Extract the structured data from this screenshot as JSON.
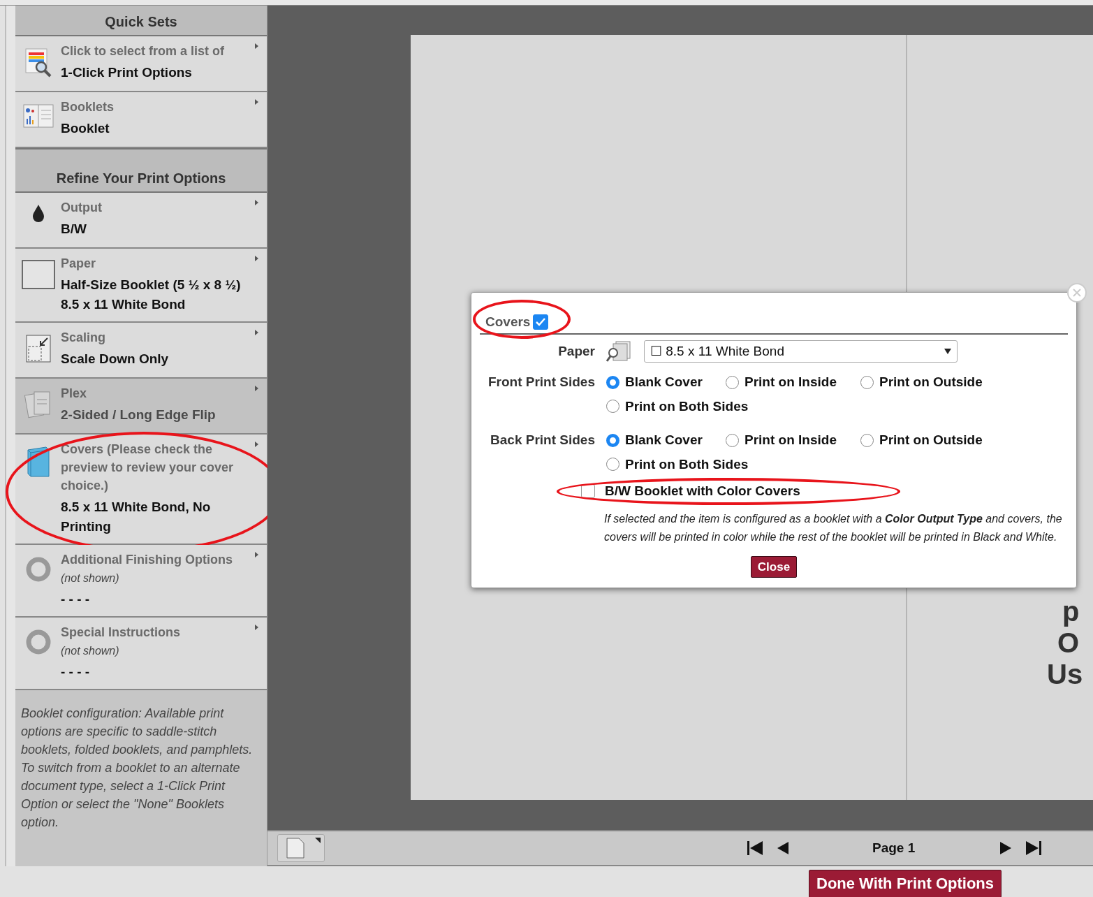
{
  "sidebar": {
    "sections": [
      {
        "title": "Quick Sets",
        "items": [
          {
            "label": "Click to select from a list of",
            "value": "1-Click Print Options",
            "disabled": false,
            "circled": false
          },
          {
            "label": "Booklets",
            "value": "Booklet",
            "disabled": false,
            "circled": false
          }
        ]
      },
      {
        "title": "Refine Your Print Options",
        "items": [
          {
            "label": "Output",
            "value": "B/W",
            "disabled": false,
            "circled": false
          },
          {
            "label": "Paper",
            "value": "Half-Size Booklet (5 ½ x 8 ½)",
            "value_2": "8.5 x 11 White Bond",
            "disabled": false,
            "circled": false
          },
          {
            "label": "Scaling",
            "value": "Scale Down Only",
            "disabled": false,
            "circled": false
          },
          {
            "label": "Plex",
            "value": "2-Sided / Long Edge Flip",
            "disabled": true,
            "circled": false
          },
          {
            "label": "Covers (Please check the preview to review your cover choice.)",
            "value": "8.5 x 11 White Bond, No Printing",
            "disabled": false,
            "circled": true
          },
          {
            "label": "Additional Finishing Options",
            "note": "(not shown)",
            "value": "- - - -",
            "disabled": false,
            "circled": false
          },
          {
            "label": "Special Instructions",
            "note": "(not shown)",
            "value": "- - - -",
            "disabled": false,
            "circled": false
          }
        ]
      }
    ],
    "help": "Booklet configuration: Available print options are specific to saddle-stitch booklets, folded booklets, and pamphlets. To switch from a booklet to an alternate document type, select a 1-Click Print Option or select the \"None\" Booklets option."
  },
  "preview": {
    "fragments": [
      "p",
      "O",
      "Us"
    ]
  },
  "dialog": {
    "title": "Covers",
    "checked": true,
    "circled": true,
    "paper": {
      "label": "Paper",
      "value": "☐ 8.5 x 11 White Bond"
    },
    "groups": [
      {
        "label": "Front Print Sides",
        "options": [
          {
            "label": "Blank Cover",
            "selected": true
          },
          {
            "label": "Print on Inside",
            "selected": false
          },
          {
            "label": "Print on Outside",
            "selected": false
          },
          {
            "label": "Print on Both Sides",
            "selected": false
          }
        ]
      },
      {
        "label": "Back Print Sides",
        "options": [
          {
            "label": "Blank Cover",
            "selected": true
          },
          {
            "label": "Print on Inside",
            "selected": false
          },
          {
            "label": "Print on Outside",
            "selected": false
          },
          {
            "label": "Print on Both Sides",
            "selected": false
          }
        ]
      }
    ],
    "color_covers": {
      "label": "B/W Booklet with Color Covers",
      "checked": false,
      "circled": true,
      "description": "If selected and the item is configured as a booklet with a **Color Output Type** and covers, the covers will be printed in color while the rest of the booklet will be printed in Black and White."
    },
    "close": "Close"
  },
  "toolbar": {
    "page": "Page 1"
  },
  "done": "Done With Print Options"
}
